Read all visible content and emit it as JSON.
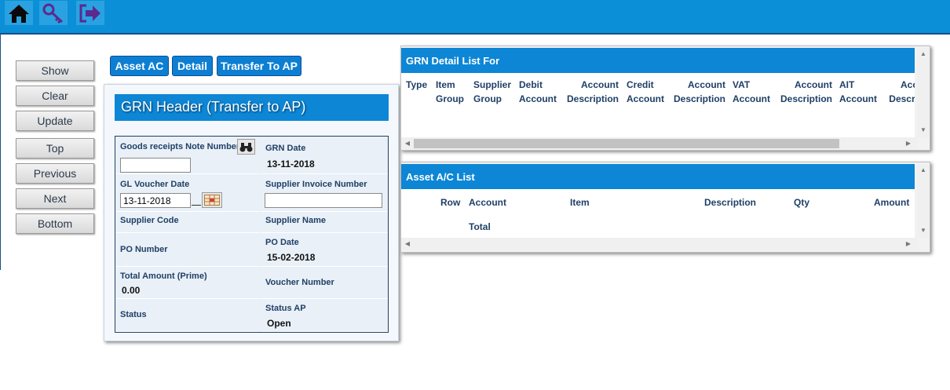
{
  "nav_buttons": [
    "Show",
    "Clear",
    "Update",
    "Top",
    "Previous",
    "Next",
    "Bottom"
  ],
  "tabs": [
    "Asset AC",
    "Detail",
    "Transfer To AP"
  ],
  "header": {
    "title": "GRN Header (Transfer to AP)",
    "grn_number_label": "Goods receipts Note Number",
    "grn_number_value": "",
    "grn_date_label": "GRN Date",
    "grn_date_value": "13-11-2018",
    "gl_voucher_date_label": "GL Voucher Date",
    "gl_voucher_date_value": "13-11-2018",
    "supplier_invoice_label": "Supplier Invoice Number",
    "supplier_invoice_value": "",
    "supplier_code_label": "Supplier Code",
    "supplier_name_label": "Supplier Name",
    "po_number_label": "PO Number",
    "po_date_label": "PO Date",
    "po_date_value": "15-02-2018",
    "total_amount_label": "Total Amount (Prime)",
    "total_amount_value": "0.00",
    "voucher_number_label": "Voucher Number",
    "status_label": "Status",
    "status_ap_label": "Status AP",
    "status_ap_value": "Open"
  },
  "grn_detail": {
    "title": "GRN Detail List For",
    "columns": [
      [
        "Type",
        ""
      ],
      [
        "Item",
        "Group"
      ],
      [
        "Supplier",
        "Group"
      ],
      [
        "Debit",
        "Account"
      ],
      [
        "Account",
        "Description"
      ],
      [
        "Credit",
        "Account"
      ],
      [
        "Account",
        "Description"
      ],
      [
        "VAT",
        "Account"
      ],
      [
        "Account",
        "Description"
      ],
      [
        "AIT",
        "Account"
      ],
      [
        "Acc",
        "Descri"
      ]
    ]
  },
  "asset_list": {
    "title": "Asset A/C List",
    "columns": [
      "Row",
      "Account",
      "Item",
      "Description",
      "Qty",
      "Amount"
    ],
    "total_label": "Total"
  },
  "colors": {
    "topbar": "#0b8fd6",
    "panel_title": "#0d86d6",
    "label": "#1f3f66"
  }
}
